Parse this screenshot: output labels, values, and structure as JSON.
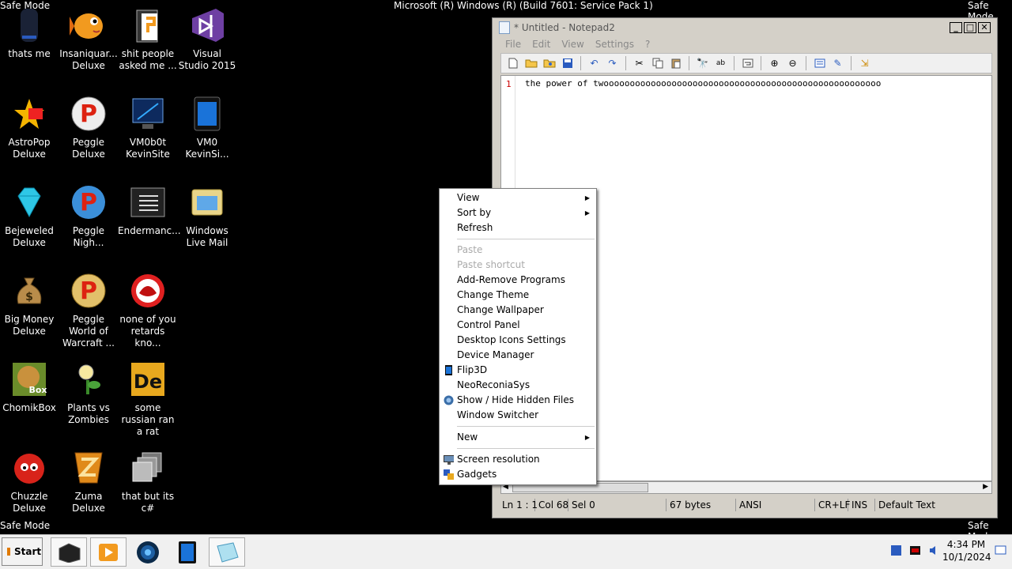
{
  "os": {
    "title_bar_text": "Microsoft (R) Windows (R) (Build 7601: Service Pack 1)",
    "safe_mode_label": "Safe Mode"
  },
  "desktop_icons": [
    {
      "label": "thats me",
      "icon": "speaker-icon"
    },
    {
      "label": "Insaniquar... Deluxe",
      "icon": "fish-icon"
    },
    {
      "label": "shit people asked me ...",
      "icon": "folder-icon"
    },
    {
      "label": "Visual Studio 2015",
      "icon": "visual-studio-icon"
    },
    {
      "label": "AstroPop Deluxe",
      "icon": "astropop-icon"
    },
    {
      "label": "Peggle Deluxe",
      "icon": "peggle-icon"
    },
    {
      "label": "VM0b0t KevinSite",
      "icon": "monitor-icon"
    },
    {
      "label": "VM0 KevinSi...",
      "icon": "tablet-icon"
    },
    {
      "label": "Bejeweled Deluxe",
      "icon": "gem-icon"
    },
    {
      "label": "Peggle Nigh...",
      "icon": "peggle-night-icon"
    },
    {
      "label": "Endermanc...",
      "icon": "terminal-icon"
    },
    {
      "label": "Windows Live Mail",
      "icon": "mail-icon"
    },
    {
      "label": "Big Money Deluxe",
      "icon": "money-bag-icon"
    },
    {
      "label": "Peggle World of Warcraft ...",
      "icon": "peggle-wow-icon"
    },
    {
      "label": "none of you retards kno...",
      "icon": "red-monster-icon"
    },
    {
      "label": "ChomikBox",
      "icon": "hamster-icon"
    },
    {
      "label": "Plants vs Zombies",
      "icon": "plant-icon"
    },
    {
      "label": "some russian ran a rat",
      "icon": "de-app-icon"
    },
    {
      "label": "Chuzzle Deluxe",
      "icon": "chuzzle-icon"
    },
    {
      "label": "Zuma Deluxe",
      "icon": "zuma-icon"
    },
    {
      "label": "that but its c#",
      "icon": "stacked-windows-icon"
    }
  ],
  "notepad": {
    "title": "* Untitled - Notepad2",
    "menu": [
      "File",
      "Edit",
      "View",
      "Settings",
      "?"
    ],
    "line_number": "1",
    "text": "the power of twooooooooooooooooooooooooooooooooooooooooooooooooooooo",
    "status": {
      "position": "Ln 1 : 1",
      "col": "Col 68",
      "sel": "Sel 0",
      "size": "67 bytes",
      "encoding": "ANSI",
      "eol": "CR+LF",
      "mode": "INS",
      "scheme": "Default Text"
    }
  },
  "context_menu": {
    "view": "View",
    "sort_by": "Sort by",
    "refresh": "Refresh",
    "paste": "Paste",
    "paste_shortcut": "Paste shortcut",
    "add_remove": "Add-Remove Programs",
    "change_theme": "Change Theme",
    "change_wallpaper": "Change Wallpaper",
    "control_panel": "Control Panel",
    "desktop_icons_settings": "Desktop Icons Settings",
    "device_manager": "Device Manager",
    "flip3d": "Flip3D",
    "neoreconiasys": "NeoReconiaSys",
    "show_hide": "Show / Hide Hidden Files",
    "window_switcher": "Window Switcher",
    "new": "New",
    "screen_resolution": "Screen resolution",
    "gadgets": "Gadgets"
  },
  "taskbar": {
    "start_label": "Start",
    "time": "4:34 PM",
    "date": "10/1/2024"
  }
}
